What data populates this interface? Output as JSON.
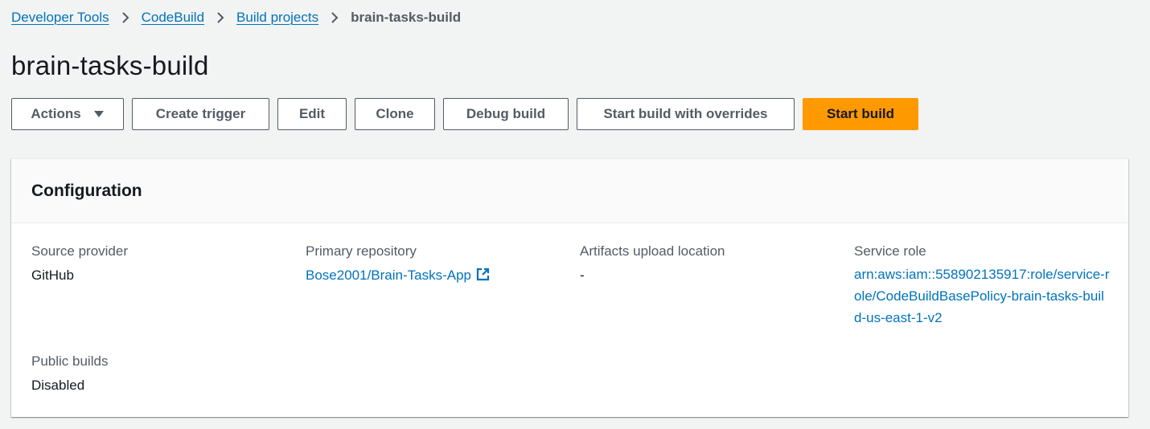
{
  "breadcrumb": {
    "items": [
      "Developer Tools",
      "CodeBuild",
      "Build projects"
    ],
    "current": "brain-tasks-build"
  },
  "page": {
    "title": "brain-tasks-build"
  },
  "toolbar": {
    "actions_label": "Actions",
    "create_trigger_label": "Create trigger",
    "edit_label": "Edit",
    "clone_label": "Clone",
    "debug_build_label": "Debug build",
    "start_overrides_label": "Start build with overrides",
    "start_build_label": "Start build"
  },
  "configuration": {
    "title": "Configuration",
    "source_provider": {
      "label": "Source provider",
      "value": "GitHub"
    },
    "primary_repository": {
      "label": "Primary repository",
      "value": "Bose2001/Brain-Tasks-App"
    },
    "artifacts_upload": {
      "label": "Artifacts upload location",
      "value": "-"
    },
    "service_role": {
      "label": "Service role",
      "value": "arn:aws:iam::558902135917:role/service-role/CodeBuildBasePolicy-brain-tasks-build-us-east-1-v2"
    },
    "public_builds": {
      "label": "Public builds",
      "value": "Disabled"
    }
  },
  "colors": {
    "link": "#0073bb",
    "primary_button": "#ff9900",
    "background": "#f2f3f3"
  }
}
